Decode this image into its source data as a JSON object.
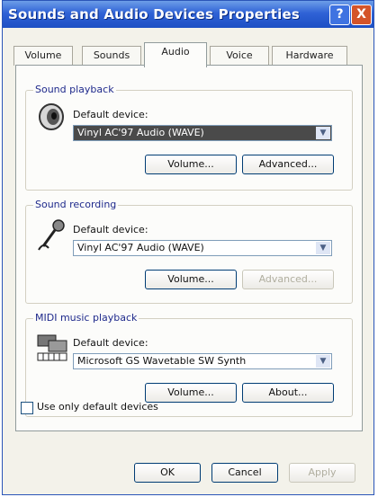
{
  "window": {
    "title": "Sounds and Audio Devices Properties",
    "help_label": "?",
    "close_label": "X"
  },
  "tabs": [
    {
      "label": "Volume"
    },
    {
      "label": "Sounds"
    },
    {
      "label": "Audio",
      "selected": true
    },
    {
      "label": "Voice"
    },
    {
      "label": "Hardware"
    }
  ],
  "playback": {
    "group_label": "Sound playback",
    "default_label": "Default device:",
    "device": "Vinyl AC'97 Audio (WAVE)",
    "volume_label": "Volume...",
    "advanced_label": "Advanced..."
  },
  "recording": {
    "group_label": "Sound recording",
    "default_label": "Default device:",
    "device": "Vinyl AC'97 Audio (WAVE)",
    "volume_label": "Volume...",
    "advanced_label": "Advanced..."
  },
  "midi": {
    "group_label": "MIDI music playback",
    "default_label": "Default device:",
    "device": "Microsoft GS Wavetable SW Synth",
    "volume_label": "Volume...",
    "about_label": "About..."
  },
  "checkbox": {
    "label": "Use only default devices",
    "checked": false
  },
  "buttons": {
    "ok": "OK",
    "cancel": "Cancel",
    "apply": "Apply"
  },
  "icons": {
    "speaker": "speaker-icon",
    "mic": "microphone-icon",
    "midi": "midi-keyboard-icon",
    "dropdown": "chevron-down-icon"
  }
}
